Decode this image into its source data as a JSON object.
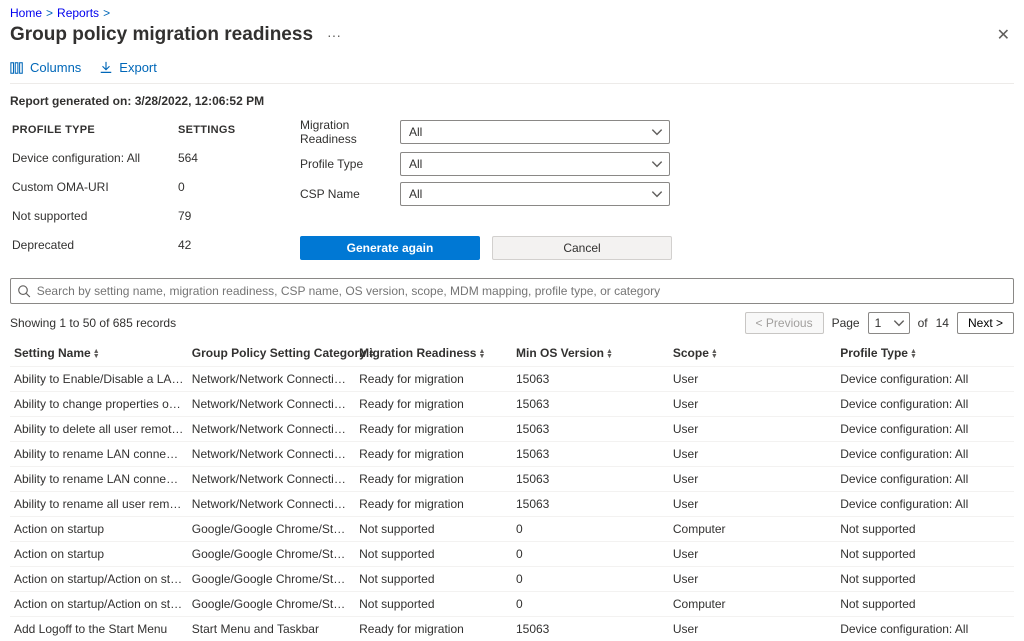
{
  "breadcrumb": {
    "home": "Home",
    "reports": "Reports"
  },
  "page_title": "Group policy migration readiness",
  "close_label": "✕",
  "toolbar": {
    "columns": "Columns",
    "export": "Export"
  },
  "report_generated": {
    "label": "Report generated on:",
    "value": "3/28/2022, 12:06:52 PM"
  },
  "summary": {
    "headers": {
      "profile_type": "PROFILE TYPE",
      "settings": "SETTINGS"
    },
    "rows": [
      {
        "profile_type": "Device configuration: All",
        "settings": "564"
      },
      {
        "profile_type": "Custom OMA-URI",
        "settings": "0"
      },
      {
        "profile_type": "Not supported",
        "settings": "79"
      },
      {
        "profile_type": "Deprecated",
        "settings": "42"
      }
    ]
  },
  "filters": {
    "migration_readiness": {
      "label": "Migration Readiness",
      "value": "All"
    },
    "profile_type": {
      "label": "Profile Type",
      "value": "All"
    },
    "csp_name": {
      "label": "CSP Name",
      "value": "All"
    }
  },
  "actions": {
    "generate": "Generate again",
    "cancel": "Cancel"
  },
  "search": {
    "placeholder": "Search by setting name, migration readiness, CSP name, OS version, scope, MDM mapping, profile type, or category"
  },
  "paging": {
    "record_text": "Showing 1 to 50 of 685 records",
    "previous": "< Previous",
    "page_label": "Page",
    "current_page": "1",
    "of_label": "of",
    "total_pages": "14",
    "next": "Next >"
  },
  "table": {
    "headers": {
      "setting_name": "Setting Name",
      "category": "Group Policy Setting Category",
      "migration": "Migration Readiness",
      "min_os": "Min OS Version",
      "scope": "Scope",
      "profile_type": "Profile Type"
    },
    "rows": [
      {
        "setting_name": "Ability to Enable/Disable a LAN connection",
        "category": "Network/Network Connections",
        "migration": "Ready for migration",
        "min_os": "15063",
        "scope": "User",
        "profile_type": "Device configuration: All"
      },
      {
        "setting_name": "Ability to change properties of an all user re...",
        "category": "Network/Network Connections",
        "migration": "Ready for migration",
        "min_os": "15063",
        "scope": "User",
        "profile_type": "Device configuration: All"
      },
      {
        "setting_name": "Ability to delete all user remote access conn...",
        "category": "Network/Network Connections",
        "migration": "Ready for migration",
        "min_os": "15063",
        "scope": "User",
        "profile_type": "Device configuration: All"
      },
      {
        "setting_name": "Ability to rename LAN connections",
        "category": "Network/Network Connections",
        "migration": "Ready for migration",
        "min_os": "15063",
        "scope": "User",
        "profile_type": "Device configuration: All"
      },
      {
        "setting_name": "Ability to rename LAN connections or remot...",
        "category": "Network/Network Connections",
        "migration": "Ready for migration",
        "min_os": "15063",
        "scope": "User",
        "profile_type": "Device configuration: All"
      },
      {
        "setting_name": "Ability to rename all user remote access con...",
        "category": "Network/Network Connections",
        "migration": "Ready for migration",
        "min_os": "15063",
        "scope": "User",
        "profile_type": "Device configuration: All"
      },
      {
        "setting_name": "Action on startup",
        "category": "Google/Google Chrome/Startup pages",
        "migration": "Not supported",
        "min_os": "0",
        "scope": "Computer",
        "profile_type": "Not supported"
      },
      {
        "setting_name": "Action on startup",
        "category": "Google/Google Chrome/Startup pages",
        "migration": "Not supported",
        "min_os": "0",
        "scope": "User",
        "profile_type": "Not supported"
      },
      {
        "setting_name": "Action on startup/Action on startup",
        "category": "Google/Google Chrome/Startup pages",
        "migration": "Not supported",
        "min_os": "0",
        "scope": "User",
        "profile_type": "Not supported"
      },
      {
        "setting_name": "Action on startup/Action on startup",
        "category": "Google/Google Chrome/Startup pages",
        "migration": "Not supported",
        "min_os": "0",
        "scope": "Computer",
        "profile_type": "Not supported"
      },
      {
        "setting_name": "Add Logoff to the Start Menu",
        "category": "Start Menu and Taskbar",
        "migration": "Ready for migration",
        "min_os": "15063",
        "scope": "User",
        "profile_type": "Device configuration: All"
      }
    ]
  }
}
